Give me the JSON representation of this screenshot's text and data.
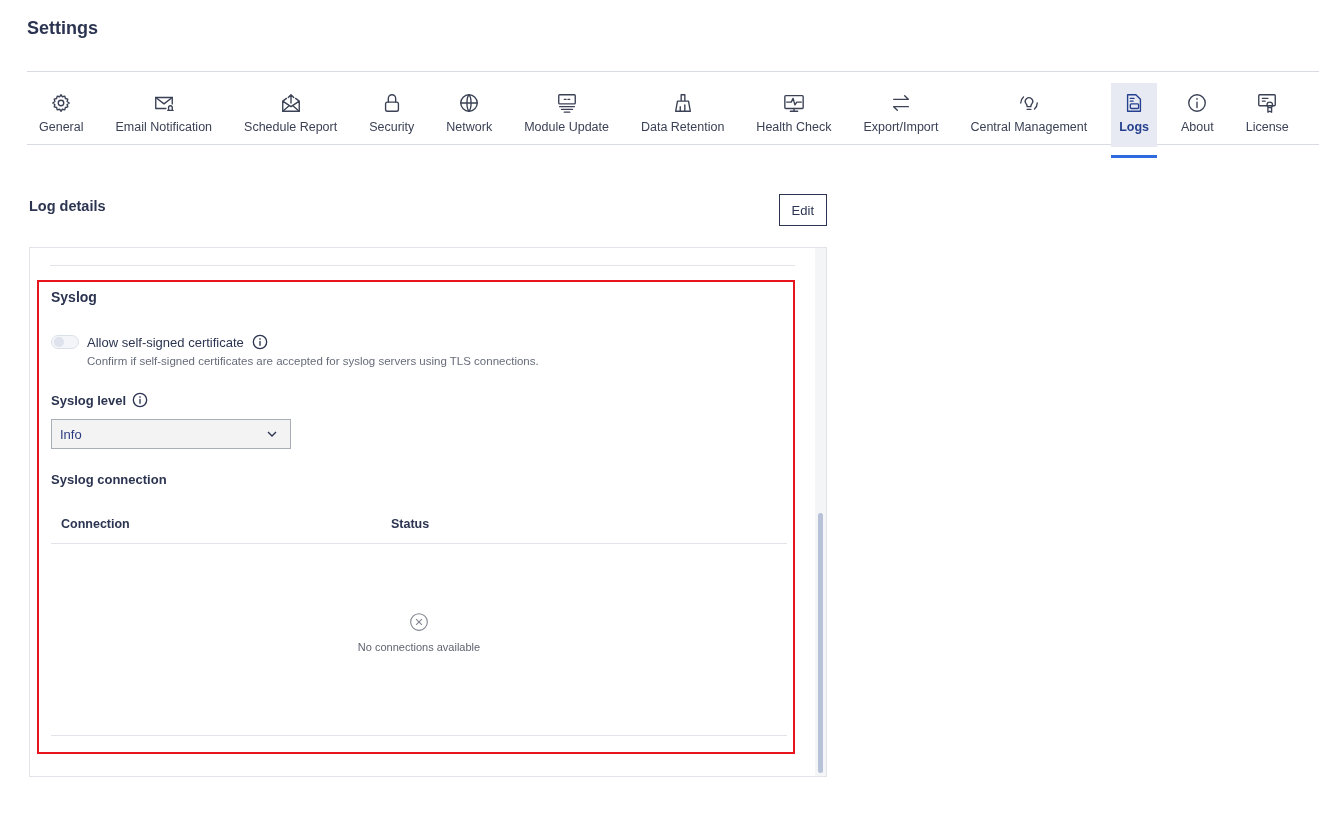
{
  "page": {
    "title": "Settings"
  },
  "tabs": [
    {
      "label": "General",
      "selected": false
    },
    {
      "label": "Email Notification",
      "selected": false
    },
    {
      "label": "Schedule Report",
      "selected": false
    },
    {
      "label": "Security",
      "selected": false
    },
    {
      "label": "Network",
      "selected": false
    },
    {
      "label": "Module Update",
      "selected": false
    },
    {
      "label": "Data Retention",
      "selected": false
    },
    {
      "label": "Health Check",
      "selected": false
    },
    {
      "label": "Export/Import",
      "selected": false
    },
    {
      "label": "Central Management",
      "selected": false
    },
    {
      "label": "Logs",
      "selected": true
    },
    {
      "label": "About",
      "selected": false
    },
    {
      "label": "License",
      "selected": false
    }
  ],
  "section": {
    "title": "Log details",
    "edit_button": "Edit"
  },
  "syslog": {
    "title": "Syslog",
    "toggle": {
      "label": "Allow self-signed certificate",
      "description": "Confirm if self-signed certificates are accepted for syslog servers using TLS connections.",
      "on": false,
      "disabled": true
    },
    "level": {
      "label": "Syslog level",
      "value": "Info"
    },
    "connection": {
      "title": "Syslog connection",
      "columns": [
        "Connection",
        "Status"
      ],
      "empty_text": "No connections available"
    }
  }
}
